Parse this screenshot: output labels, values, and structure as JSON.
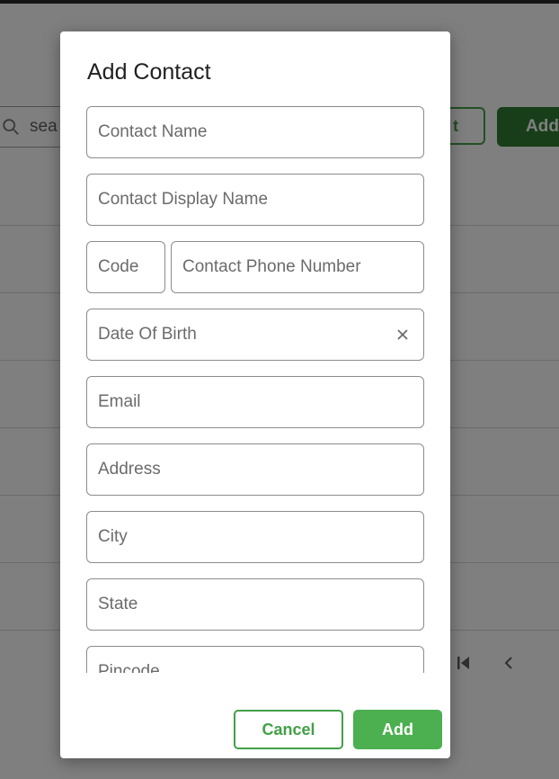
{
  "background": {
    "search_text": "sea",
    "outline_button_tail": "t",
    "add_button_label": "Add"
  },
  "dialog": {
    "title": "Add Contact",
    "fields": {
      "contact_name": "Contact Name",
      "display_name": "Contact Display Name",
      "code": "Code",
      "phone": "Contact Phone Number",
      "dob": "Date Of Birth",
      "email": "Email",
      "address": "Address",
      "city": "City",
      "state": "State",
      "pincode": "Pincode"
    },
    "cancel_label": "Cancel",
    "add_label": "Add"
  },
  "colors": {
    "accent": "#4caf50",
    "accent_dark": "#2e7d32",
    "overlay": "rgba(0,0,0,0.5)"
  },
  "icons": {
    "search": "search-icon",
    "clear": "close-icon",
    "first_page": "first-page-icon",
    "prev_page": "chevron-left-icon"
  }
}
